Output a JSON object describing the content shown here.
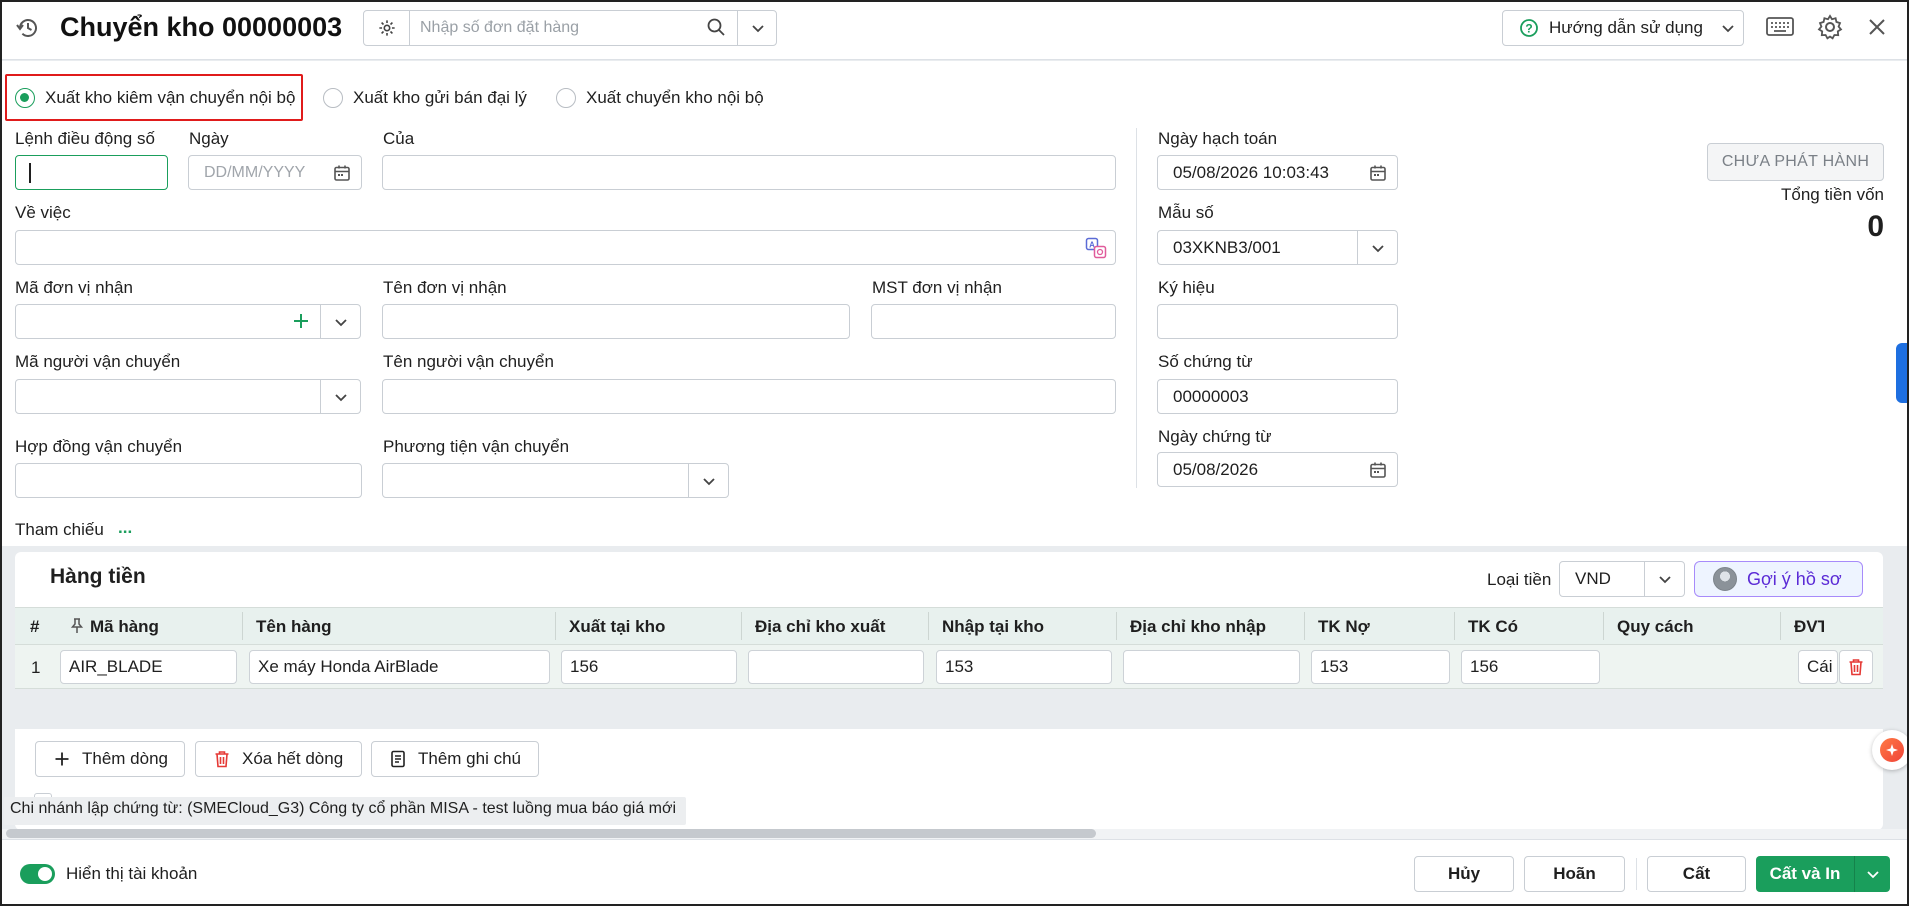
{
  "header": {
    "title": "Chuyển kho 00000003",
    "search_placeholder": "Nhập số đơn đặt hàng",
    "help_label": "Hướng dẫn sử dụng"
  },
  "export_type": {
    "options": [
      "Xuất kho kiêm vận chuyển nội bộ",
      "Xuất kho gửi bán đại lý",
      "Xuất chuyển kho nội bộ"
    ],
    "selected": "Xuất kho kiêm vận chuyển nội bộ"
  },
  "form": {
    "order_no_label": "Lệnh điều động số",
    "date_label": "Ngày",
    "date_placeholder": "DD/MM/YYYY",
    "of_label": "Của",
    "subject_label": "Về việc",
    "recv_code_label": "Mã đơn vị nhận",
    "recv_name_label": "Tên đơn vị nhận",
    "recv_tax_label": "MST đơn vị nhận",
    "carrier_code_label": "Mã người vận chuyển",
    "carrier_name_label": "Tên người vận chuyển",
    "contract_label": "Hợp đồng vận chuyển",
    "vehicle_label": "Phương tiện vận chuyển"
  },
  "voucher": {
    "posting_date_label": "Ngày hạch toán",
    "posting_date": "05/08/2026 10:03:43",
    "template_label": "Mẫu số",
    "template": "03XKNB3/001",
    "symbol_label": "Ký hiệu",
    "doc_no_label": "Số chứng từ",
    "doc_no": "00000003",
    "doc_date_label": "Ngày chứng từ",
    "doc_date": "05/08/2026"
  },
  "status": {
    "label": "CHƯA PHÁT HÀNH",
    "total_label": "Tổng tiền vốn",
    "total_value": "0"
  },
  "reference": {
    "label": "Tham chiếu",
    "more": "..."
  },
  "grid": {
    "title": "Hàng tiền",
    "currency_label": "Loại tiền",
    "currency": "VND",
    "suggest_label": "Gợi ý hồ sơ",
    "columns": [
      "#",
      "Mã hàng",
      "Tên hàng",
      "Xuất tại kho",
      "Địa chỉ kho xuất",
      "Nhập tại kho",
      "Địa chỉ kho nhập",
      "TK Nợ",
      "TK Có",
      "Quy cách",
      "ĐVT"
    ],
    "rows": [
      {
        "no": "1",
        "code": "AIR_BLADE",
        "name": "Xe máy Honda AirBlade",
        "from_wh": "156",
        "from_addr": "",
        "to_wh": "153",
        "to_addr": "",
        "debit": "153",
        "credit": "156",
        "spec": "",
        "unit": "Cái"
      }
    ]
  },
  "actions": {
    "add_row": "Thêm dòng",
    "delete_all": "Xóa hết dòng",
    "add_note": "Thêm ghi chú"
  },
  "branch_note": "Chi nhánh lập chứng từ: (SMECloud_G3) Công ty cổ phần MISA - test luồng mua báo giá mới",
  "footer": {
    "show_accounts": "Hiển thị tài khoản",
    "cancel": "Hủy",
    "undo": "Hoãn",
    "save": "Cất",
    "save_print": "Cất và In"
  },
  "colors": {
    "accent": "#1a9e5c",
    "highlight": "#e01b1b",
    "side_tab": "#1e6fe0"
  }
}
